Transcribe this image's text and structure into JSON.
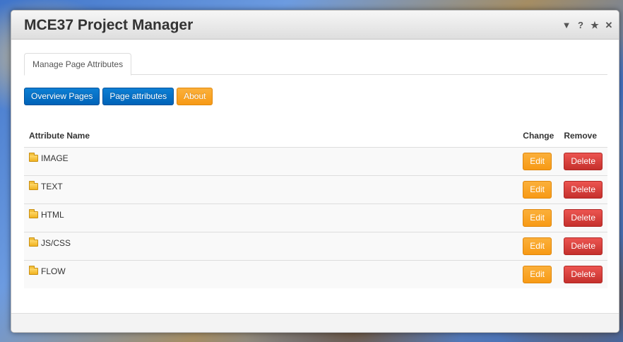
{
  "window": {
    "title": "MCE37 Project Manager",
    "controls": [
      {
        "name": "minimize-icon",
        "glyph": "▼"
      },
      {
        "name": "help-icon",
        "glyph": "?"
      },
      {
        "name": "star-icon",
        "glyph": "★"
      },
      {
        "name": "close-icon",
        "glyph": "✕"
      }
    ]
  },
  "tabs": [
    {
      "label": "Manage Page Attributes",
      "active": true
    }
  ],
  "buttons": {
    "overview_pages": "Overview Pages",
    "page_attributes": "Page attributes",
    "about": "About"
  },
  "table": {
    "headers": {
      "name": "Attribute Name",
      "change": "Change",
      "remove": "Remove"
    },
    "rows": [
      {
        "name": "IMAGE",
        "edit": "Edit",
        "delete": "Delete"
      },
      {
        "name": "TEXT",
        "edit": "Edit",
        "delete": "Delete"
      },
      {
        "name": "HTML",
        "edit": "Edit",
        "delete": "Delete"
      },
      {
        "name": "JS/CSS",
        "edit": "Edit",
        "delete": "Delete"
      },
      {
        "name": "FLOW",
        "edit": "Edit",
        "delete": "Delete"
      }
    ]
  },
  "colors": {
    "primary_blue": "#0063b8",
    "warning_orange": "#f79a15",
    "danger_red": "#c5302c"
  }
}
